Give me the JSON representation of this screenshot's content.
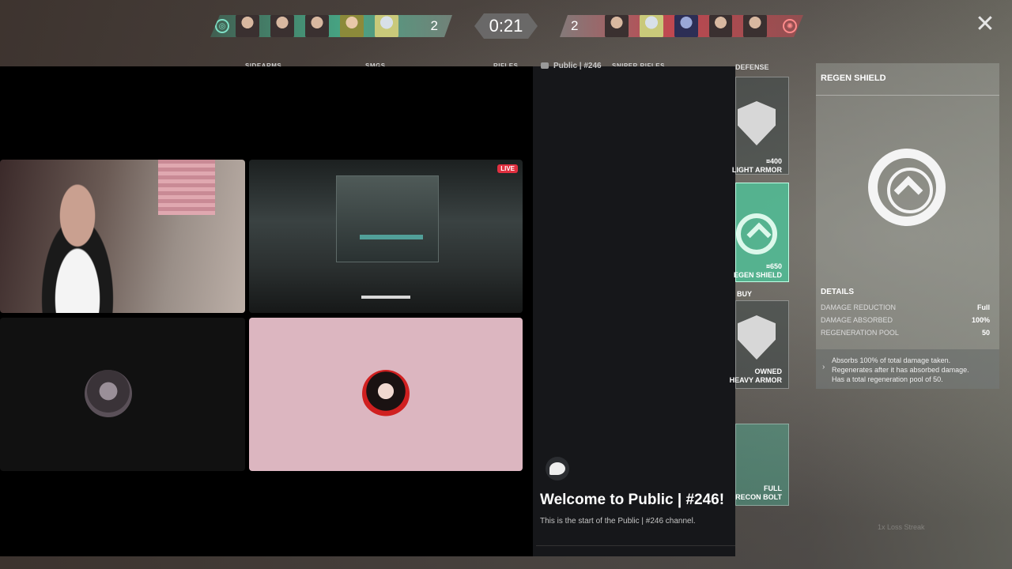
{
  "hud": {
    "left_score": "2",
    "right_score": "2",
    "timer": "0:21",
    "close_glyph": "✕"
  },
  "categories": [
    "SIDEARMS",
    "SMGS",
    "RIFLES",
    "SNIPER RIFLES"
  ],
  "discord": {
    "channel_name": "Public | #246",
    "live_badge": "LIVE",
    "welcome_title": "Welcome to Public | #246!",
    "welcome_subtitle": "This is the start of the Public | #246 channel."
  },
  "shop": {
    "section_title": "DEFENSE",
    "light_armor": {
      "price": "¤400",
      "label": "LIGHT ARMOR"
    },
    "regen_shield": {
      "price": "¤650",
      "label": "EGEN SHIELD"
    },
    "buy_label": "BUY",
    "heavy_armor": {
      "status": "OWNED",
      "label": "HEAVY ARMOR"
    },
    "recon_bolt": {
      "status": "FULL",
      "label": "RECON BOLT"
    }
  },
  "detail": {
    "title": "REGEN SHIELD",
    "details_heading": "DETAILS",
    "stats": [
      {
        "label": "DAMAGE REDUCTION",
        "value": "Full"
      },
      {
        "label": "DAMAGE ABSORBED",
        "value": "100%"
      },
      {
        "label": "REGENERATION POOL",
        "value": "50"
      }
    ],
    "description": [
      "Absorbs 100% of total damage taken.",
      "Regenerates after it has absorbed damage.",
      "Has a total regeneration pool of 50."
    ]
  },
  "footer": {
    "loss_streak": "1x Loss Streak"
  },
  "colors": {
    "ally": "#4fc3a1",
    "enemy": "#e05060",
    "shop_selected": "#50be96"
  }
}
